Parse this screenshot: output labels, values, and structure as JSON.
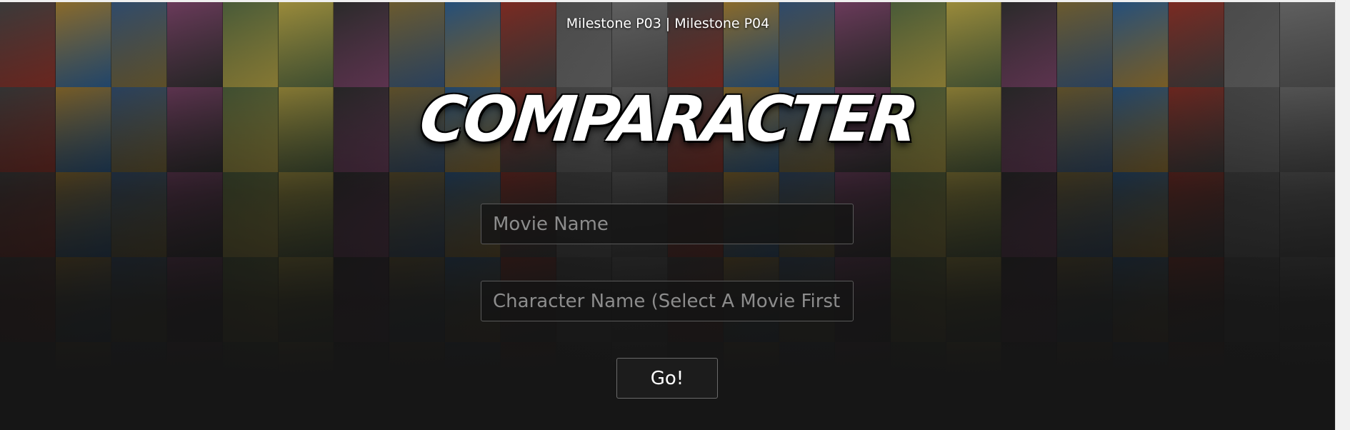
{
  "nav": {
    "links": [
      "Milestone P03",
      "Milestone P04"
    ],
    "separator": "|"
  },
  "logo": {
    "text": "COMPARACTER"
  },
  "form": {
    "movie_placeholder": "Movie Name",
    "character_placeholder": "Character Name (Select A Movie First)",
    "go_label": "Go!"
  },
  "colors": {
    "background": "#141414",
    "text": "#ffffff",
    "field_border": "#5a5a5a",
    "poster_palette": [
      "#3a3a3a",
      "#6b5a2e",
      "#2f4a6b",
      "#7a2a22",
      "#485a38",
      "#5f5f5f",
      "#2a2a2a",
      "#8a6a2a",
      "#254f7a",
      "#6a3a5a",
      "#4a4a4a",
      "#9a8a3a"
    ]
  }
}
